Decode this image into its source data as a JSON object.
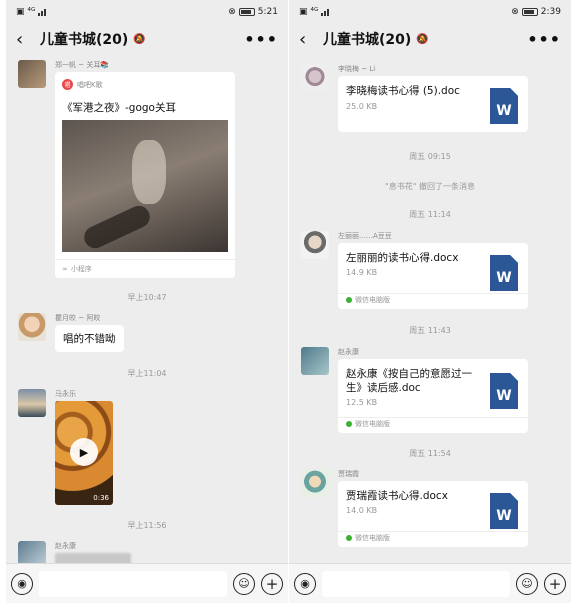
{
  "left": {
    "status": {
      "left_icons": "▣ ⁴ᴳ",
      "right_icons": "⊗",
      "time": "5:21"
    },
    "title": "儿童书城(20)",
    "messages": {
      "m1_sender": "郑一帆 ~ 关耳📚",
      "m1_app_name": "唱吧K歌",
      "m1_card_title": "《军港之夜》-gogo关耳",
      "m1_card_footer": "小程序",
      "t1": "早上10:47",
      "m2_sender": "瞿月皎 ~ 阿皎",
      "m2_text": "唱的不错呦",
      "t2": "早上11:04",
      "m3_sender": "马永乐",
      "m3_duration": "0:36",
      "t3": "早上11:56",
      "m4_sender": "赵永康"
    }
  },
  "right": {
    "status": {
      "left_icons": "▣ ⁴ᴳ",
      "right_icons": "⊗",
      "time": "2:39"
    },
    "title": "儿童书城(20)",
    "messages": {
      "f1_sender": "李晓梅 ~ Li",
      "f1_name": "李晓梅读书心得 (5).doc",
      "f1_size": "25.0 KB",
      "t1": "周五 09:15",
      "recall": "\"息书花\" 撤回了一条消息",
      "t2": "周五 11:14",
      "f2_sender": "左丽丽……A豆豆",
      "f2_name": "左丽丽的读书心得.docx",
      "f2_size": "14.9 KB",
      "f2_source": "微信电脑版",
      "t3": "周五 11:43",
      "f3_sender": "赵永康",
      "f3_name": "赵永康《按自己的意愿过一生》读后感.doc",
      "f3_size": "12.5 KB",
      "f3_source": "微信电脑版",
      "t4": "周五 11:54",
      "f4_sender": "贾瑞霞",
      "f4_name": "贾瑞霞读书心得.docx",
      "f4_size": "14.0 KB",
      "f4_source": "微信电脑版"
    }
  },
  "icons": {
    "back": "‹",
    "more": "•••",
    "mute": "🔕",
    "voice": "◉",
    "emoji": "☺",
    "plus": "+",
    "word": "W",
    "play": "▶"
  }
}
